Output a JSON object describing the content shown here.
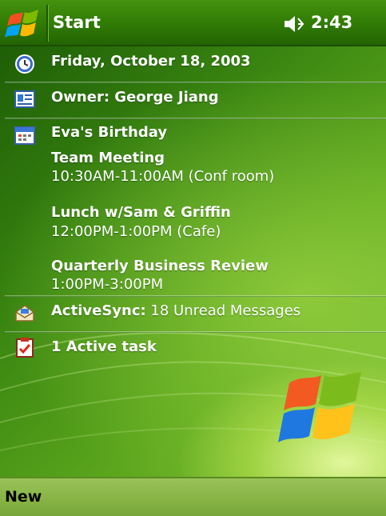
{
  "titlebar": {
    "title": "Start",
    "time": "2:43",
    "start_icon": "windows-flag-icon",
    "volume_icon": "speaker-icon"
  },
  "today": {
    "date": "Friday, October 18, 2003",
    "owner_label": "Owner: George Jiang",
    "calendar": {
      "all_day_event": "Eva's Birthday",
      "appointments": [
        {
          "title": "Team Meeting",
          "time": "10:30AM-11:00AM (Conf room)"
        },
        {
          "title": "Lunch w/Sam & Griffin",
          "time": "12:00PM-1:00PM (Cafe)"
        },
        {
          "title": "Quarterly Business Review",
          "time": "1:00PM-3:00PM"
        }
      ]
    },
    "activesync": {
      "label": "ActiveSync:",
      "status": " 18 Unread Messages"
    },
    "tasks": "1 Active task"
  },
  "menubar": {
    "left_softkey": "New"
  },
  "colors": {
    "titlebar": "#2f7a04",
    "menubar": "#86b344",
    "text": "#ffffff"
  }
}
